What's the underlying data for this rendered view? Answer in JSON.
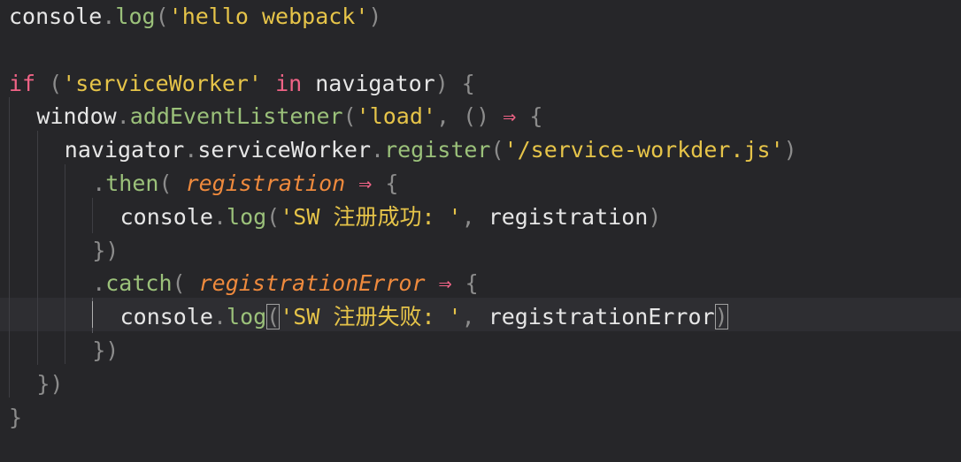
{
  "editor": {
    "lines": [
      {
        "indent": 0,
        "tokens": [
          {
            "t": "console",
            "k": "def"
          },
          {
            "t": ".",
            "k": "punc"
          },
          {
            "t": "log",
            "k": "method"
          },
          {
            "t": "(",
            "k": "punc"
          },
          {
            "t": "'hello webpack'",
            "k": "str"
          },
          {
            "t": ")",
            "k": "punc"
          }
        ]
      },
      {
        "indent": 0,
        "tokens": []
      },
      {
        "indent": 0,
        "tokens": [
          {
            "t": "if",
            "k": "kw"
          },
          {
            "t": " (",
            "k": "punc"
          },
          {
            "t": "'serviceWorker'",
            "k": "str"
          },
          {
            "t": " ",
            "k": "def"
          },
          {
            "t": "in",
            "k": "kw"
          },
          {
            "t": " navigator",
            "k": "def"
          },
          {
            "t": ") {",
            "k": "punc"
          }
        ]
      },
      {
        "indent": 1,
        "tokens": [
          {
            "t": "window",
            "k": "def"
          },
          {
            "t": ".",
            "k": "punc"
          },
          {
            "t": "addEventListener",
            "k": "method"
          },
          {
            "t": "(",
            "k": "punc"
          },
          {
            "t": "'load'",
            "k": "str"
          },
          {
            "t": ", () ",
            "k": "punc"
          },
          {
            "t": "⇒",
            "k": "arrow"
          },
          {
            "t": " {",
            "k": "punc"
          }
        ]
      },
      {
        "indent": 2,
        "tokens": [
          {
            "t": "navigator",
            "k": "def"
          },
          {
            "t": ".",
            "k": "punc"
          },
          {
            "t": "serviceWorker",
            "k": "def"
          },
          {
            "t": ".",
            "k": "punc"
          },
          {
            "t": "register",
            "k": "method"
          },
          {
            "t": "(",
            "k": "punc"
          },
          {
            "t": "'/service-workder.js'",
            "k": "str"
          },
          {
            "t": ")",
            "k": "punc"
          }
        ]
      },
      {
        "indent": 3,
        "tokens": [
          {
            "t": ".",
            "k": "punc"
          },
          {
            "t": "then",
            "k": "method"
          },
          {
            "t": "( ",
            "k": "punc"
          },
          {
            "t": "registration",
            "k": "param"
          },
          {
            "t": " ",
            "k": "def"
          },
          {
            "t": "⇒",
            "k": "arrow"
          },
          {
            "t": " {",
            "k": "punc"
          }
        ]
      },
      {
        "indent": 4,
        "tokens": [
          {
            "t": "console",
            "k": "def"
          },
          {
            "t": ".",
            "k": "punc"
          },
          {
            "t": "log",
            "k": "method"
          },
          {
            "t": "(",
            "k": "punc"
          },
          {
            "t": "'SW 注册成功: '",
            "k": "str"
          },
          {
            "t": ", ",
            "k": "punc"
          },
          {
            "t": "registration",
            "k": "def"
          },
          {
            "t": ")",
            "k": "punc"
          }
        ]
      },
      {
        "indent": 3,
        "tokens": [
          {
            "t": "})",
            "k": "punc"
          }
        ]
      },
      {
        "indent": 3,
        "tokens": [
          {
            "t": ".",
            "k": "punc"
          },
          {
            "t": "catch",
            "k": "method"
          },
          {
            "t": "( ",
            "k": "punc"
          },
          {
            "t": "registrationError",
            "k": "param"
          },
          {
            "t": " ",
            "k": "def"
          },
          {
            "t": "⇒",
            "k": "arrow"
          },
          {
            "t": " {",
            "k": "punc"
          }
        ]
      },
      {
        "indent": 4,
        "tokens": [
          {
            "t": "console",
            "k": "def"
          },
          {
            "t": ".",
            "k": "punc"
          },
          {
            "t": "log",
            "k": "method"
          },
          {
            "t": "(",
            "k": "punc",
            "box": true
          },
          {
            "t": "'SW 注册失败: '",
            "k": "str"
          },
          {
            "t": ", ",
            "k": "punc"
          },
          {
            "t": "registrationError",
            "k": "def"
          },
          {
            "t": ")",
            "k": "punc",
            "box": true
          }
        ]
      },
      {
        "indent": 3,
        "tokens": [
          {
            "t": "})",
            "k": "punc"
          }
        ]
      },
      {
        "indent": 1,
        "tokens": [
          {
            "t": "})",
            "k": "punc"
          }
        ]
      },
      {
        "indent": 0,
        "tokens": [
          {
            "t": "}",
            "k": "punc"
          }
        ]
      }
    ]
  }
}
